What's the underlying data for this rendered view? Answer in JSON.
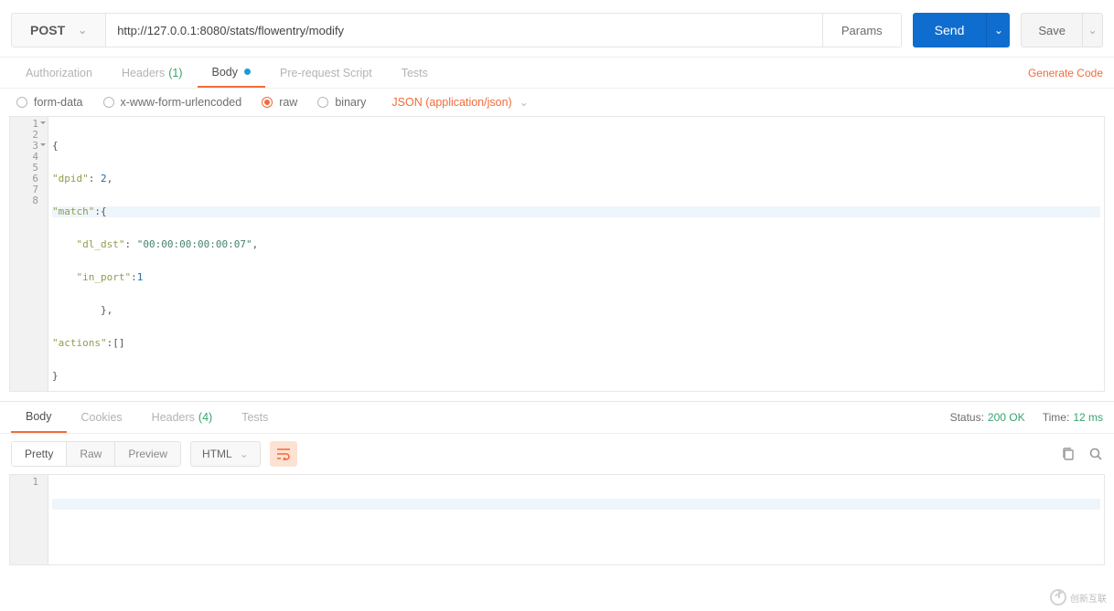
{
  "request": {
    "method": "POST",
    "url": "http://127.0.0.1:8080/stats/flowentry/modify",
    "params_label": "Params",
    "send_label": "Send",
    "save_label": "Save"
  },
  "req_tabs": {
    "authorization": "Authorization",
    "headers": "Headers",
    "headers_count": "(1)",
    "body": "Body",
    "prerequest": "Pre-request Script",
    "tests": "Tests",
    "generate_code": "Generate Code"
  },
  "body_type": {
    "form_data": "form-data",
    "urlencoded": "x-www-form-urlencoded",
    "raw": "raw",
    "binary": "binary",
    "content_type": "JSON (application/json)"
  },
  "editor": {
    "gutter": [
      "1",
      "2",
      "3",
      "4",
      "5",
      "6",
      "7",
      "8"
    ],
    "code": {
      "l1": "{",
      "l2_k": "\"dpid\"",
      "l2_p": ": ",
      "l2_v": "2",
      "l2_t": ",",
      "l3_k": "\"match\"",
      "l3_p": ":{",
      "l4_k": "\"dl_dst\"",
      "l4_p": ": ",
      "l4_v": "\"00:00:00:00:00:07\"",
      "l4_t": ",",
      "l5_k": "\"in_port\"",
      "l5_p": ":",
      "l5_v": "1",
      "l6": "},",
      "l7_k": "\"actions\"",
      "l7_p": ":[]",
      "l8": "}"
    }
  },
  "response": {
    "tabs": {
      "body": "Body",
      "cookies": "Cookies",
      "headers": "Headers",
      "headers_count": "(4)",
      "tests": "Tests"
    },
    "status_label": "Status:",
    "status_value": "200 OK",
    "time_label": "Time:",
    "time_value": "12 ms"
  },
  "view": {
    "pretty": "Pretty",
    "raw": "Raw",
    "preview": "Preview",
    "format": "HTML"
  },
  "resp_editor": {
    "gutter": [
      "1"
    ]
  },
  "watermark": "创新互联"
}
